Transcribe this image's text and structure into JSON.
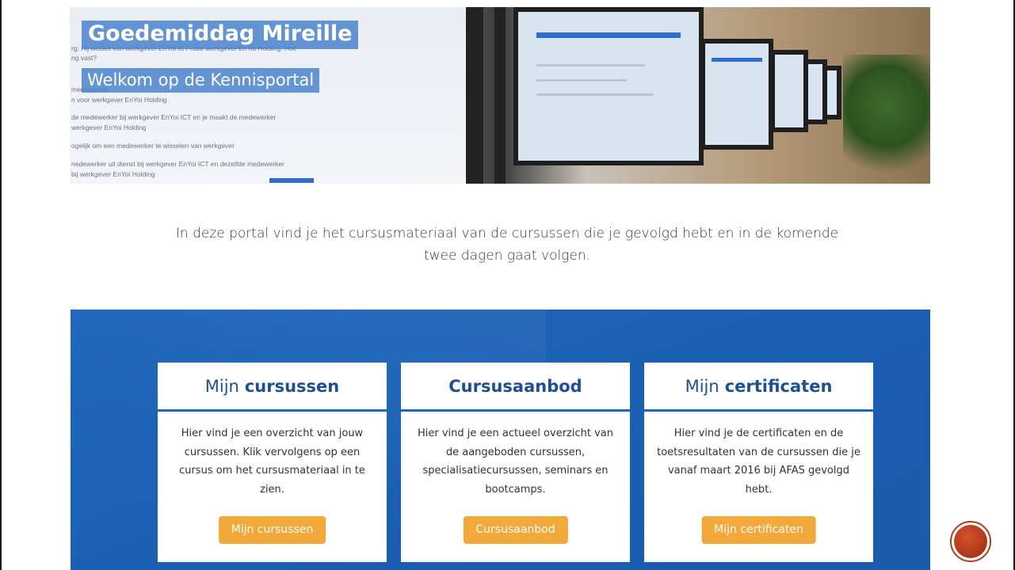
{
  "hero": {
    "title": "Goedemiddag Mireille",
    "subtitle": "Welkom op de Kennisportal",
    "background_text": [
      "rg: Hij wisselt van werkgever EnYoi ICT naar werkgever EnYoi Holding. Hoe",
      "ng vast?",
      "medewerker",
      "n voor werkgever EnYoi Holding",
      "de medewerker bij werkgever EnYoi ICT en je maakt de medewerker",
      "werkgever EnYoi Holding",
      "ogelijk om een medewerker te wisselen van werkgever",
      "nedewerker uit dienst bij werkgever EnYoi ICT en dezelfde medewerker",
      "bij werkgever EnYoi Holding"
    ]
  },
  "intro": {
    "line1": "In deze portal vind je het cursusmateriaal van de cursussen die je gevolgd hebt en in de komende",
    "line2": "twee dagen gaat volgen."
  },
  "cards": [
    {
      "title_light": "Mijn",
      "title_bold": "cursussen",
      "body": "Hier vind je een overzicht van jouw cursussen. Klik vervolgens op een cursus om het cursusmateriaal in te zien.",
      "button": "Mijn cursussen"
    },
    {
      "title_light": "",
      "title_bold": "Cursusaanbod",
      "body": "Hier vind je een actueel overzicht van de aangeboden cursussen, specialisatiecursussen, seminars en bootcamps.",
      "button": "Cursusaanbod"
    },
    {
      "title_light": "Mijn",
      "title_bold": "certificaten",
      "body": "Hier vind je de certificaten en de toetsresultaten van de cursussen die je vanaf maart 2016 bij AFAS gevolgd hebt.",
      "button": "Mijn certificaten"
    }
  ],
  "colors": {
    "accent_blue": "#1e67bd",
    "button_orange": "#f3a93a",
    "heading_blue": "#1d4f97",
    "nav_red": "#b23a1c"
  },
  "nav": {
    "icon": "next-slide-circle-icon"
  }
}
